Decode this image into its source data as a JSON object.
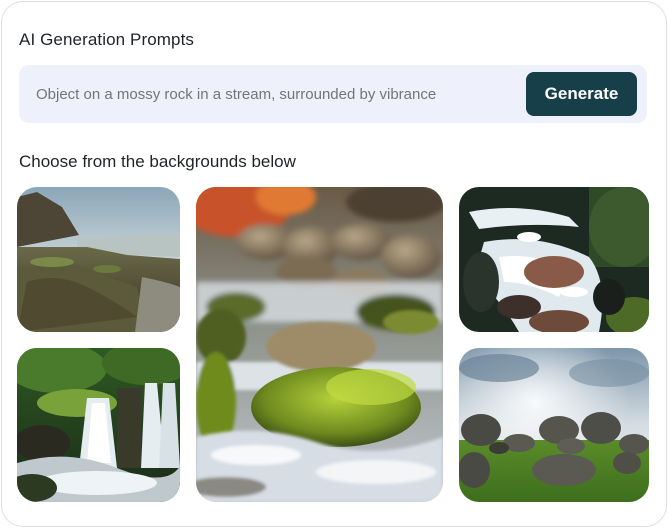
{
  "header": {
    "title": "AI Generation Prompts"
  },
  "prompt": {
    "placeholder": "Object on a mossy rock in a stream, surrounded by vibrance",
    "generate_label": "Generate"
  },
  "gallery": {
    "subtitle": "Choose from the backgrounds below",
    "images": [
      {
        "subject": "rocky coastline"
      },
      {
        "subject": "mossy rocks in stream"
      },
      {
        "subject": "rushing rapids"
      },
      {
        "subject": "forest waterfall"
      },
      {
        "subject": "boulders on grassland"
      }
    ]
  },
  "colors": {
    "button_bg": "#173f4a",
    "prompt_bg": "#eef1fb",
    "text": "#1f2329",
    "placeholder_text": "#6b7380"
  }
}
